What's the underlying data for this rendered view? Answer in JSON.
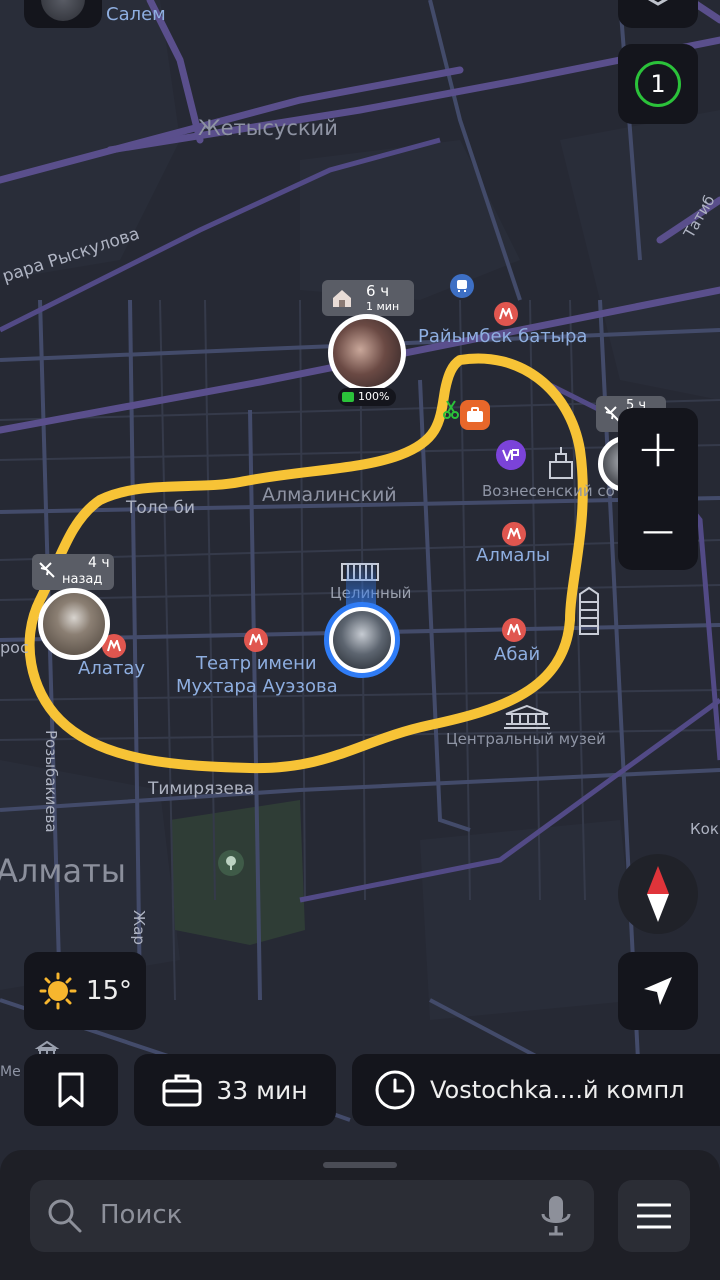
{
  "map": {
    "labels": {
      "salem": "Салем",
      "zhetysu": "Жетысуский",
      "ryskulova": "рара Рыскулова",
      "raiymbek": "Райымбек батыра",
      "almalinsky": "Алмалинский",
      "tole_bi": "Толе би",
      "voznesensky": "Вознесенский со",
      "almaly": "Алмалы",
      "tselinny": "Целинный",
      "alatau": "Алатау",
      "teatr_1": "Театр имени",
      "teatr_2": "Мухтара Ауэзова",
      "abai": "Абай",
      "museum": "Центральный музей",
      "timiryazeva": "Тимирязева",
      "almaty": "Алматы",
      "rozybakieva": "Розыбакиева",
      "zharokova": "Жар",
      "tatibekova": "Татиб",
      "kok": "Кок",
      "ros": "рос",
      "mede": "Ме"
    },
    "pins": {
      "top_time": "6 ч",
      "top_sub": "1 мин",
      "battery": "100%",
      "left_time": "4 ч",
      "left_sub": "назад",
      "right_time": "5 ч"
    }
  },
  "controls": {
    "badge_count": "1",
    "zoom_in": "+",
    "zoom_out": "—"
  },
  "weather": {
    "temp": "15°"
  },
  "shortcuts": {
    "work": "33 мин",
    "place": "Vostochka....й компл"
  },
  "search": {
    "placeholder": "Поиск"
  },
  "colors": {
    "accent_gold": "#f7c336",
    "metro": "#e0564f",
    "online": "#2bc23a",
    "user_ring": "#2f7cf6"
  }
}
